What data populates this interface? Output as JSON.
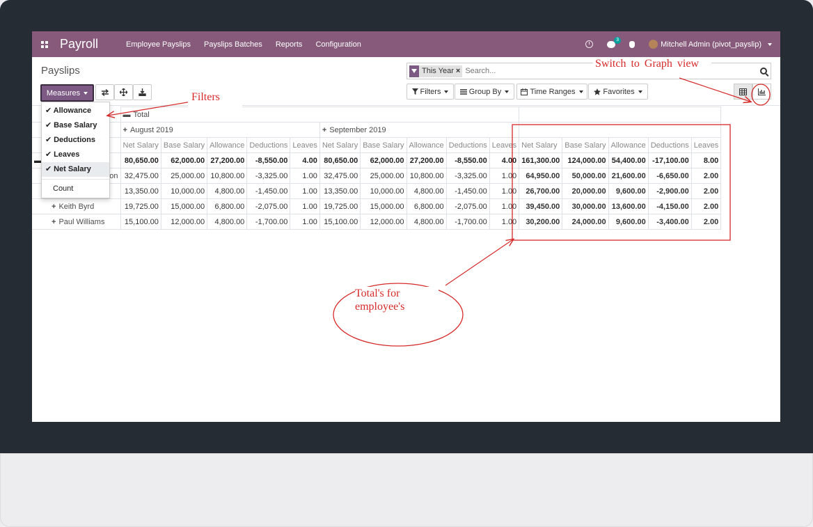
{
  "navbar": {
    "app_name": "Payroll",
    "menu": [
      "Employee Payslips",
      "Payslips Batches",
      "Reports",
      "Configuration"
    ],
    "chat_badge": "3",
    "user": "Mitchell Admin (pivot_payslip)"
  },
  "control_panel": {
    "breadcrumb": "Payslips",
    "measures_label": "Measures",
    "search_facet": "This Year",
    "search_placeholder": "Search...",
    "filters_label": "Filters",
    "groupby_label": "Group By",
    "timeranges_label": "Time Ranges",
    "favorites_label": "Favorites"
  },
  "measures_menu": {
    "items": [
      {
        "label": "Allowance",
        "checked": true
      },
      {
        "label": "Base Salary",
        "checked": true
      },
      {
        "label": "Deductions",
        "checked": true
      },
      {
        "label": "Leaves",
        "checked": true
      },
      {
        "label": "Net Salary",
        "checked": true
      }
    ],
    "count_label": "Count"
  },
  "pivot": {
    "total_header": "Total",
    "months": [
      "August 2019",
      "September 2019"
    ],
    "measures": [
      "Net Salary",
      "Base Salary",
      "Allowance",
      "Deductions",
      "Leaves"
    ],
    "total_row": {
      "aug": [
        "80,650.00",
        "62,000.00",
        "27,200.00",
        "-8,550.00",
        "4.00"
      ],
      "sep": [
        "80,650.00",
        "62,000.00",
        "27,200.00",
        "-8,550.00",
        "4.00"
      ],
      "tot": [
        "161,300.00",
        "124,000.00",
        "54,400.00",
        "-17,100.00",
        "8.00"
      ]
    },
    "rows": [
      {
        "name": "on",
        "aug": [
          "32,475.00",
          "25,000.00",
          "10,800.00",
          "-3,325.00",
          "1.00"
        ],
        "sep": [
          "32,475.00",
          "25,000.00",
          "10,800.00",
          "-3,325.00",
          "1.00"
        ],
        "tot": [
          "64,950.00",
          "50,000.00",
          "21,600.00",
          "-6,650.00",
          "2.00"
        ]
      },
      {
        "name": "",
        "aug": [
          "13,350.00",
          "10,000.00",
          "4,800.00",
          "-1,450.00",
          "1.00"
        ],
        "sep": [
          "13,350.00",
          "10,000.00",
          "4,800.00",
          "-1,450.00",
          "1.00"
        ],
        "tot": [
          "26,700.00",
          "20,000.00",
          "9,600.00",
          "-2,900.00",
          "2.00"
        ]
      },
      {
        "name": "Keith Byrd",
        "aug": [
          "19,725.00",
          "15,000.00",
          "6,800.00",
          "-2,075.00",
          "1.00"
        ],
        "sep": [
          "19,725.00",
          "15,000.00",
          "6,800.00",
          "-2,075.00",
          "1.00"
        ],
        "tot": [
          "39,450.00",
          "30,000.00",
          "13,600.00",
          "-4,150.00",
          "2.00"
        ]
      },
      {
        "name": "Paul Williams",
        "aug": [
          "15,100.00",
          "12,000.00",
          "4,800.00",
          "-1,700.00",
          "1.00"
        ],
        "sep": [
          "15,100.00",
          "12,000.00",
          "4,800.00",
          "-1,700.00",
          "1.00"
        ],
        "tot": [
          "30,200.00",
          "24,000.00",
          "9,600.00",
          "-3,400.00",
          "2.00"
        ]
      }
    ]
  },
  "annotations": {
    "filters": "Filters",
    "switch_graph": "Switch to Graph view",
    "totals_line1": "Total's for",
    "totals_line2": "employee's"
  },
  "colors": {
    "navbar": "#875a7b",
    "primary_button": "#7c5a84",
    "annotation": "#d62a2a"
  }
}
